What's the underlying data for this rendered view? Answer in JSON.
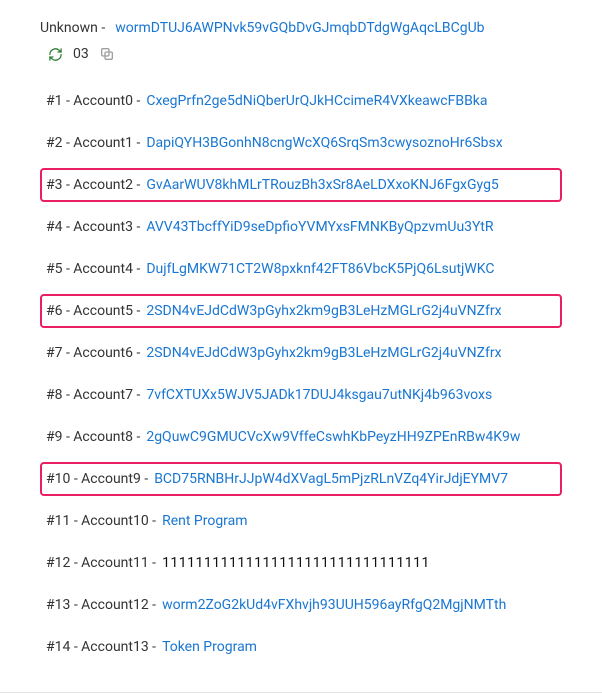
{
  "header": {
    "unknown_label": "Unknown -",
    "unknown_address": "wormDTUJ6AWPNvk59vGQbDvGJmqbDTdgWgAqcLBCgUb"
  },
  "tools": {
    "refresh_icon": "refresh",
    "count": "03",
    "copy_icon": "copy"
  },
  "accounts": [
    {
      "idx": "#1",
      "name": "Account0",
      "value": "CxegPrfn2ge5dNiQberUrQJkHCcimeR4VXkeawcFBBka",
      "link": true,
      "highlight": false
    },
    {
      "idx": "#2",
      "name": "Account1",
      "value": "DapiQYH3BGonhN8cngWcXQ6SrqSm3cwysoznoHr6Sbsx",
      "link": true,
      "highlight": false
    },
    {
      "idx": "#3",
      "name": "Account2",
      "value": "GvAarWUV8khMLrTRouzBh3xSr8AeLDXxoKNJ6FgxGyg5",
      "link": true,
      "highlight": true
    },
    {
      "idx": "#4",
      "name": "Account3",
      "value": "AVV43TbcffYiD9seDpfioYVMYxsFMNKByQpzvmUu3YtR",
      "link": true,
      "highlight": false
    },
    {
      "idx": "#5",
      "name": "Account4",
      "value": "DujfLgMKW71CT2W8pxknf42FT86VbcK5PjQ6LsutjWKC",
      "link": true,
      "highlight": false
    },
    {
      "idx": "#6",
      "name": "Account5",
      "value": "2SDN4vEJdCdW3pGyhx2km9gB3LeHzMGLrG2j4uVNZfrx",
      "link": true,
      "highlight": true
    },
    {
      "idx": "#7",
      "name": "Account6",
      "value": "2SDN4vEJdCdW3pGyhx2km9gB3LeHzMGLrG2j4uVNZfrx",
      "link": true,
      "highlight": false
    },
    {
      "idx": "#8",
      "name": "Account7",
      "value": "7vfCXTUXx5WJV5JADk17DUJ4ksgau7utNKj4b963voxs",
      "link": true,
      "highlight": false
    },
    {
      "idx": "#9",
      "name": "Account8",
      "value": "2gQuwC9GMUCVcXw9VffeCswhKbPeyzHH9ZPEnRBw4K9w",
      "link": true,
      "highlight": false
    },
    {
      "idx": "#10",
      "name": "Account9",
      "value": "BCD75RNBHrJJpW4dXVagL5mPjzRLnVZq4YirJdjEYMV7",
      "link": true,
      "highlight": true
    },
    {
      "idx": "#11",
      "name": "Account10",
      "value": "Rent Program",
      "link": true,
      "highlight": false
    },
    {
      "idx": "#12",
      "name": "Account11",
      "value": "11111111111111111111111111111111",
      "link": false,
      "highlight": false
    },
    {
      "idx": "#13",
      "name": "Account12",
      "value": "worm2ZoG2kUd4vFXhvjh93UUH596ayRfgQ2MgjNMTth",
      "link": true,
      "highlight": false
    },
    {
      "idx": "#14",
      "name": "Account13",
      "value": "Token Program",
      "link": true,
      "highlight": false
    }
  ]
}
